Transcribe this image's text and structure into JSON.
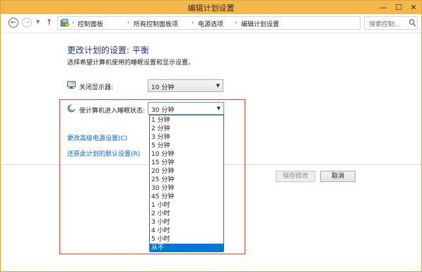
{
  "window": {
    "title": "编辑计划设置",
    "controls": {
      "minimize": "—",
      "maximize": "☐",
      "close": "✕"
    }
  },
  "nav": {
    "back_glyph": "←",
    "forward_glyph": "→",
    "up_glyph": "↑",
    "breadcrumbs": [
      "控制面板",
      "所有控制面板项",
      "电源选项",
      "编辑计划设置"
    ],
    "separator": "›",
    "refresh_glyph": "↻",
    "search_placeholder": "搜索控制..."
  },
  "content": {
    "heading": "更改计划的设置: 平衡",
    "subtext": "选择希望计算机使用的睡眠设置和显示设置。",
    "display_off": {
      "label": "关闭显示器:",
      "value": "10 分钟"
    },
    "sleep": {
      "label": "使计算机进入睡眠状态:",
      "value": "30 分钟"
    },
    "links": {
      "advanced": "更改高级电源设置(C)",
      "restore": "还原此计划的默认设置(R)"
    },
    "buttons": {
      "save": "保存修改",
      "cancel": "取消"
    },
    "sleep_options": [
      "1 分钟",
      "2 分钟",
      "3 分钟",
      "5 分钟",
      "10 分钟",
      "15 分钟",
      "20 分钟",
      "25 分钟",
      "30 分钟",
      "45 分钟",
      "1 小时",
      "2 小时",
      "3 小时",
      "4 小时",
      "5 小时",
      "从不"
    ],
    "selected_option": "从不"
  },
  "colors": {
    "titlebar": "#f3b84d",
    "heading": "#1e3287",
    "link": "#0066cc",
    "highlight": "#0078d7",
    "annotation_box": "#e8453c"
  }
}
